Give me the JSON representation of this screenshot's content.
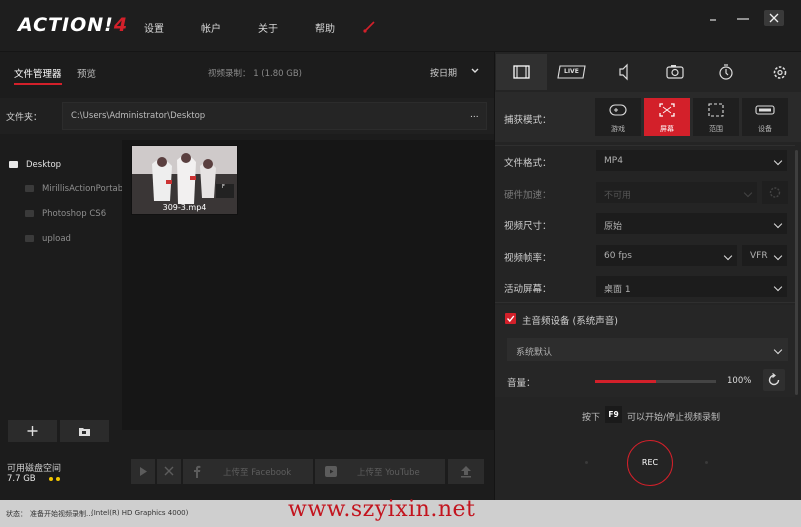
{
  "app": {
    "logo_text": "ACTION!",
    "logo_version": "4"
  },
  "menu": [
    {
      "label": "设置"
    },
    {
      "label": "帐户"
    },
    {
      "label": "关于"
    },
    {
      "label": "帮助"
    }
  ],
  "left": {
    "tabs": {
      "files": "文件管理器",
      "preview": "预览"
    },
    "recording_info": "视频录制： 1 (1.80 GB)",
    "sort_label": "按日期",
    "folder_label": "文件夹：",
    "folder_path": "C:\\Users\\Administrator\\Desktop",
    "folder_more": "...",
    "tree": [
      {
        "label": "Desktop",
        "root": true
      },
      {
        "label": "MirillisActionPortable",
        "root": false
      },
      {
        "label": "Photoshop CS6",
        "root": false
      },
      {
        "label": "upload",
        "root": false
      }
    ],
    "files": [
      {
        "name": "309-3.mp4",
        "badge": "F"
      }
    ],
    "add_button": "+",
    "disk_label": "可用磁盘空间",
    "disk_value": "7.7 GB",
    "upload_facebook": "上传至 Facebook",
    "upload_youtube": "上传至 YouTube"
  },
  "right": {
    "tab_icons": [
      "film-icon",
      "live-icon",
      "speaker-icon",
      "camera-icon",
      "stopwatch-icon",
      "gear-icon"
    ],
    "live_label": "LIVE",
    "capture_label": "捕获模式：",
    "capture_modes": [
      {
        "label": "游戏",
        "icon": "gamepad-icon",
        "active": false
      },
      {
        "label": "屏幕",
        "icon": "screen-icon",
        "active": true
      },
      {
        "label": "范围",
        "icon": "region-icon",
        "active": false
      },
      {
        "label": "设备",
        "icon": "device-icon",
        "active": false
      }
    ],
    "file_format_label": "文件格式：",
    "file_format_value": "MP4",
    "hw_accel_label": "硬件加速：",
    "hw_accel_value": "不可用",
    "video_size_label": "视频尺寸：",
    "video_size_value": "原始",
    "frame_rate_label": "视频帧率：",
    "frame_rate_value": "60 fps",
    "frame_mode_value": "VFR",
    "active_screen_label": "活动屏幕：",
    "active_screen_value": "桌面 1",
    "audio_checkbox_label": "主音频设备 (系统声音)",
    "audio_device_value": "系统默认",
    "volume_label": "音量：",
    "volume_value": "100%",
    "volume_level": 0.5,
    "hint_prefix": "按下",
    "hint_key": "F9",
    "hint_suffix": "可以开始/停止视频录制",
    "rec_label": "REC"
  },
  "status": {
    "label": "状态：",
    "text": "准备开始视频录制...",
    "gpu": "(Intel(R) HD Graphics 4000)"
  },
  "watermark": "www.szyixin.net",
  "colors": {
    "accent": "#d3202a",
    "background": "#1b1b1b",
    "panel": "#242424"
  }
}
